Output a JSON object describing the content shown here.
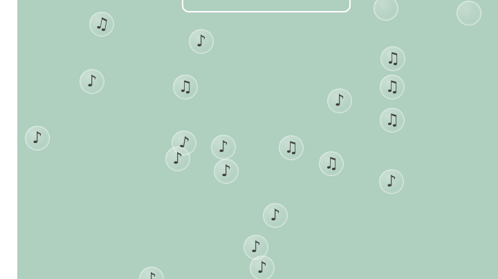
{
  "colors": {
    "background": "#afcfbf",
    "note": "#3f3f3f",
    "outline": "#ffffff"
  },
  "glyphs": {
    "eighth_note": "♪",
    "beamed_notes": "♫"
  },
  "notes": [
    {
      "id": "n1",
      "kind": "beamed_notes"
    },
    {
      "id": "n2",
      "kind": "eighth_note"
    },
    {
      "id": "n3",
      "kind": "beamed_notes"
    },
    {
      "id": "n4",
      "kind": "beamed_notes"
    },
    {
      "id": "n5",
      "kind": "eighth_note"
    },
    {
      "id": "n6",
      "kind": "beamed_notes"
    },
    {
      "id": "n7",
      "kind": "eighth_note"
    },
    {
      "id": "n8",
      "kind": "beamed_notes"
    },
    {
      "id": "n9",
      "kind": "eighth_note"
    },
    {
      "id": "n10",
      "kind": "eighth_note"
    },
    {
      "id": "n11",
      "kind": "eighth_note"
    },
    {
      "id": "n12",
      "kind": "eighth_note"
    },
    {
      "id": "n13",
      "kind": "beamed_notes"
    },
    {
      "id": "n14",
      "kind": "eighth_note"
    },
    {
      "id": "n15",
      "kind": "beamed_notes"
    },
    {
      "id": "n16",
      "kind": "eighth_note"
    },
    {
      "id": "n17",
      "kind": "eighth_note"
    },
    {
      "id": "n18",
      "kind": "eighth_note"
    },
    {
      "id": "n19",
      "kind": "eighth_note"
    },
    {
      "id": "n20",
      "kind": "eighth_note"
    },
    {
      "id": "n21",
      "kind": "eighth_note"
    }
  ]
}
